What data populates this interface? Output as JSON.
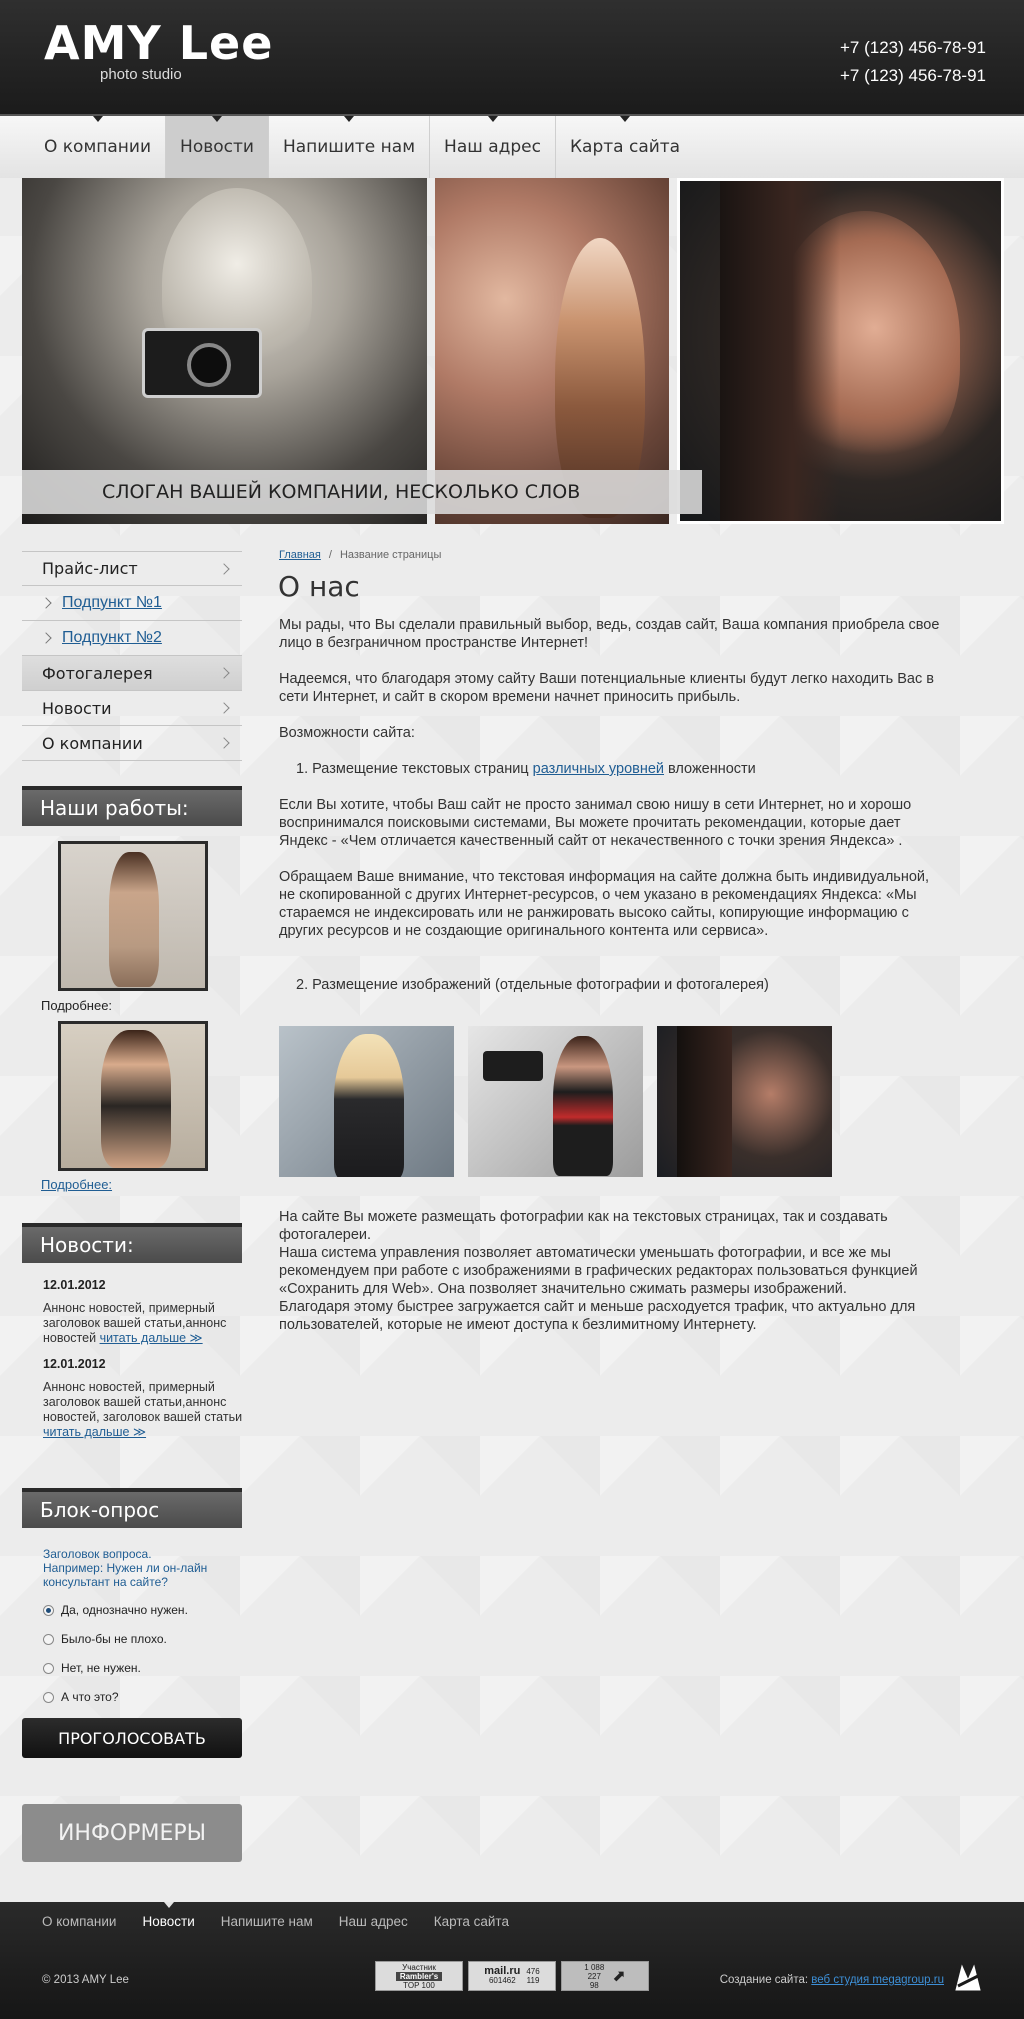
{
  "header": {
    "logo_title": "AMY Lee",
    "logo_subtitle": "photo studio",
    "phone_1": "+7 (123) 456-78-91",
    "phone_2": "+7 (123) 456-78-91"
  },
  "topnav": {
    "items": [
      {
        "label": "О компании"
      },
      {
        "label": "Новости",
        "active": true
      },
      {
        "label": "Напишите нам"
      },
      {
        "label": "Наш адрес"
      },
      {
        "label": "Карта сайта"
      }
    ]
  },
  "banner": {
    "slogan": "СЛОГАН ВАШЕЙ КОМПАНИИ, НЕСКОЛЬКО СЛОВ"
  },
  "sidebar": {
    "menu": [
      {
        "label": "Прайс-лист"
      },
      {
        "label": "Подпункт №1",
        "sub": true
      },
      {
        "label": "Подпункт №2",
        "sub": true
      },
      {
        "label": "Фотогалерея",
        "active": true
      },
      {
        "label": "Новости"
      },
      {
        "label": "О компании"
      }
    ],
    "works": {
      "title": "Наши работы:",
      "more_label": "Подробнее:",
      "more_link": "Подробнее:"
    },
    "news": {
      "title": "Новости:",
      "items": [
        {
          "date": "12.01.2012",
          "text": "Аннонс новостей, примерный заголовок вашей статьи,аннонс новостей ",
          "link": "читать дальше ≫"
        },
        {
          "date": "12.01.2012",
          "text": "Аннонс новостей, примерный заголовок вашей статьи,аннонс новостей, заголовок вашей статьи ",
          "link": "читать дальше ≫"
        }
      ]
    },
    "poll": {
      "title": "Блок-опрос",
      "question_1": "Заголовок вопроса.",
      "question_2": "Например: Нужен ли он-лайн консультант на сайте?",
      "options": [
        {
          "label": "Да, однозначно нужен.",
          "checked": true
        },
        {
          "label": "Было-бы не плохо."
        },
        {
          "label": "Нет, не нужен."
        },
        {
          "label": "А что это?"
        }
      ],
      "vote_label": "ПРОГОЛОСОВАТЬ"
    },
    "informers_label": "ИНФОРМЕРЫ"
  },
  "main": {
    "breadcrumb_home": "Главная",
    "breadcrumb_sep": "/",
    "breadcrumb_current": "Название страницы",
    "title": "О нас",
    "p1": "Мы рады, что Вы сделали правильный выбор, ведь, создав сайт, Ваша компания приобрела свое лицо в безграничном пространстве Интернет!",
    "p2": "Надеемся, что благодаря этому сайту Ваши потенциальные клиенты будут легко находить Вас в сети Интернет, и сайт в скором времени начнет приносить прибыль.",
    "p3": "Возможности сайта:",
    "li1_prefix": "1. Размещение текстовых страниц ",
    "li1_link": "различных уровней",
    "li1_suffix": " вложенности",
    "p4": "Если Вы хотите, чтобы Ваш сайт не просто занимал свою нишу в сети Интернет, но и хорошо воспринимался поисковыми системами, Вы можете прочитать рекомендации, которые дает Яндекс - «Чем отличается качественный сайт от некачественного с точки зрения Яндекса» .",
    "p5": "Обращаем Ваше внимание, что текстовая информация на сайте должна быть индивидуальной, не скопированной с других Интернет-ресурсов, о чем указано в рекомендациях Яндекса: «Мы стараемся не индексировать или не ранжировать высоко сайты, копирующие информацию с других ресурсов и не создающие оригинального контента или сервиса».",
    "li2": "2. Размещение изображений (отдельные фотографии и фотогалерея)",
    "p6": "На сайте Вы можете размещать фотографии как на текстовых страницах, так и создавать фотогалереи.",
    "p7": "Наша система управления позволяет автоматически уменьшать фотографии, и все же мы рекомендуем при работе с изображениями в графических редакторах пользоваться функцией «Сохранить для Web». Она позволяет значительно сжимать размеры изображений.",
    "p8": "Благодаря этому быстрее загружается сайт и меньше расходуется трафик, что актуально для пользователей, которые не имеют доступа к безлимитному Интернету."
  },
  "footer": {
    "nav": [
      {
        "label": "О компании"
      },
      {
        "label": "Новости",
        "active": true
      },
      {
        "label": "Напишите нам"
      },
      {
        "label": "Наш адрес"
      },
      {
        "label": "Карта сайта"
      }
    ],
    "copyright": "© 2013 AMY Lee",
    "counter_1_line_1": "Участник",
    "counter_1_line_2": "Rambler's",
    "counter_1_line_3": "TOP 100",
    "counter_2_line_1": "mail.ru",
    "counter_2_line_2": "601462",
    "counter_2_num_1": "476",
    "counter_2_num_2": "119",
    "counter_3_line_1": "1 088",
    "counter_3_line_2": "227",
    "counter_3_line_3": "98",
    "creator_label": "Создание сайта:",
    "creator_link": "веб студия megagroup.ru"
  },
  "colors": {
    "header_bg": "#222222",
    "link": "#1f5d93",
    "block_head": "#5a5a5a",
    "vote_btn": "#1a1a1a",
    "informers": "#8c8c8c"
  }
}
